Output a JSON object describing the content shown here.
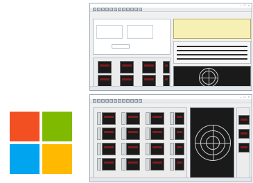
{
  "brand": {
    "logo_colors": {
      "red": "#f25022",
      "green": "#7fba00",
      "blue": "#00a4ef",
      "yellow": "#ffb900"
    }
  },
  "windows": [
    {
      "title": "",
      "window_buttons": [
        "–",
        "□",
        "×"
      ],
      "status": ""
    },
    {
      "title": "",
      "window_buttons": [
        "–",
        "□",
        "×"
      ],
      "status": ""
    }
  ]
}
